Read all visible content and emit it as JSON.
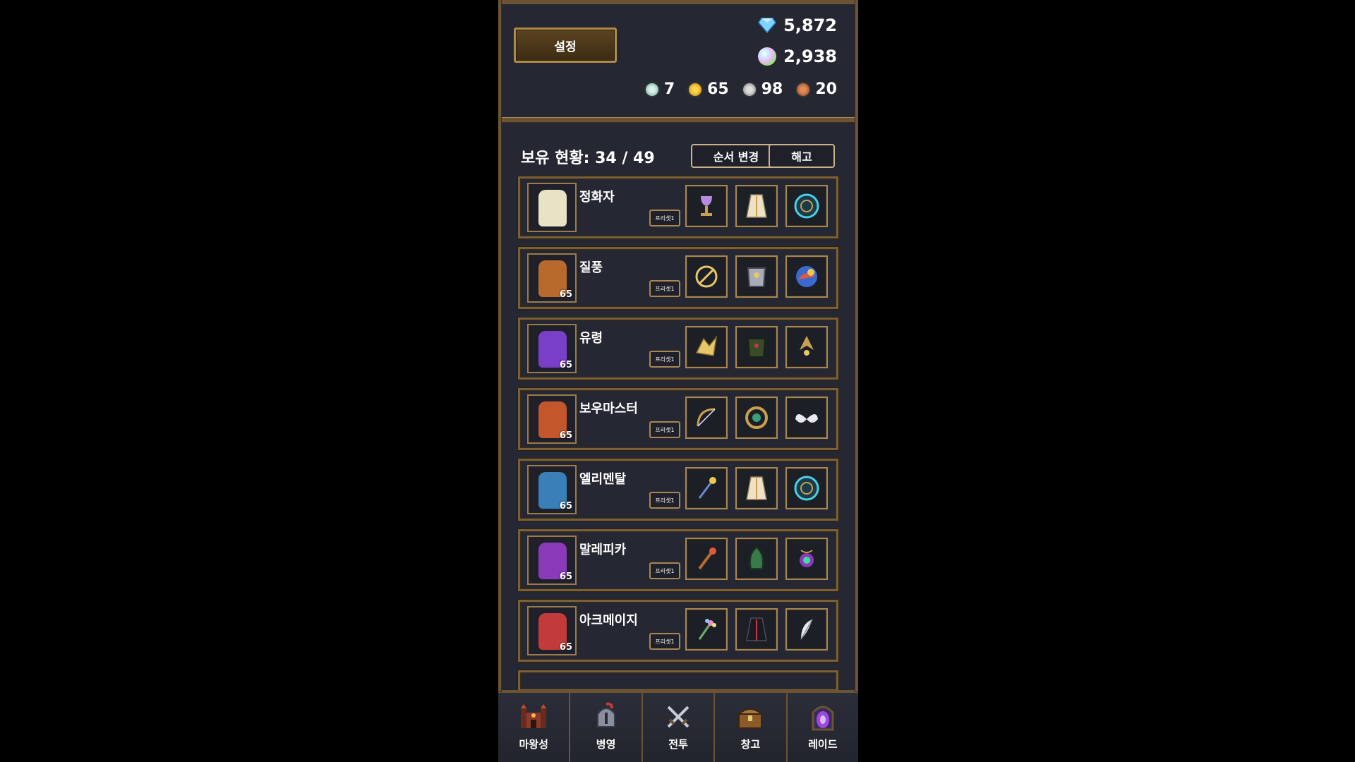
{
  "header": {
    "settings_label": "설정",
    "diamonds": "5,872",
    "orbs": "2,938",
    "coins": [
      {
        "icon": "silver-green-coin-icon",
        "value": "7"
      },
      {
        "icon": "gold-coin-icon",
        "value": "65"
      },
      {
        "icon": "silver-coin-icon",
        "value": "98"
      },
      {
        "icon": "bronze-coin-icon",
        "value": "20"
      }
    ]
  },
  "roster": {
    "owned_label": "보유 현황: 34 / 49",
    "order_button": "순서 변경",
    "dismiss_button": "해고",
    "preset_label": "프리셋1",
    "heroes": [
      {
        "name": "정화자",
        "level": "",
        "color": "#e9e2c4",
        "items": [
          "chalice-icon",
          "robe-icon",
          "rune-circle-icon"
        ]
      },
      {
        "name": "질풍",
        "level": "65",
        "color": "#b86a2c",
        "items": [
          "rune-ring-icon",
          "armor-icon",
          "orb-icon"
        ]
      },
      {
        "name": "유령",
        "level": "65",
        "color": "#7a3fc9",
        "items": [
          "golden-emblem-icon",
          "dark-armor-icon",
          "amulet-icon"
        ]
      },
      {
        "name": "보우마스터",
        "level": "65",
        "color": "#c4562c",
        "items": [
          "bow-icon",
          "gold-ring-icon",
          "wings-icon"
        ]
      },
      {
        "name": "엘리멘탈",
        "level": "65",
        "color": "#3a7fb8",
        "items": [
          "staff-icon",
          "robe-icon",
          "rune-circle-icon"
        ]
      },
      {
        "name": "말레피카",
        "level": "65",
        "color": "#8a3ab8",
        "items": [
          "wand-icon",
          "leaf-armor-icon",
          "orb-amulet-icon"
        ]
      },
      {
        "name": "아크메이지",
        "level": "65",
        "color": "#c23a3a",
        "items": [
          "flower-staff-icon",
          "dark-cloak-icon",
          "feather-icon"
        ]
      }
    ]
  },
  "nav": [
    {
      "label": "마왕성",
      "icon": "castle-icon"
    },
    {
      "label": "병영",
      "icon": "helmet-icon"
    },
    {
      "label": "전투",
      "icon": "crossed-swords-icon"
    },
    {
      "label": "창고",
      "icon": "chest-icon"
    },
    {
      "label": "레이드",
      "icon": "portal-icon"
    }
  ]
}
